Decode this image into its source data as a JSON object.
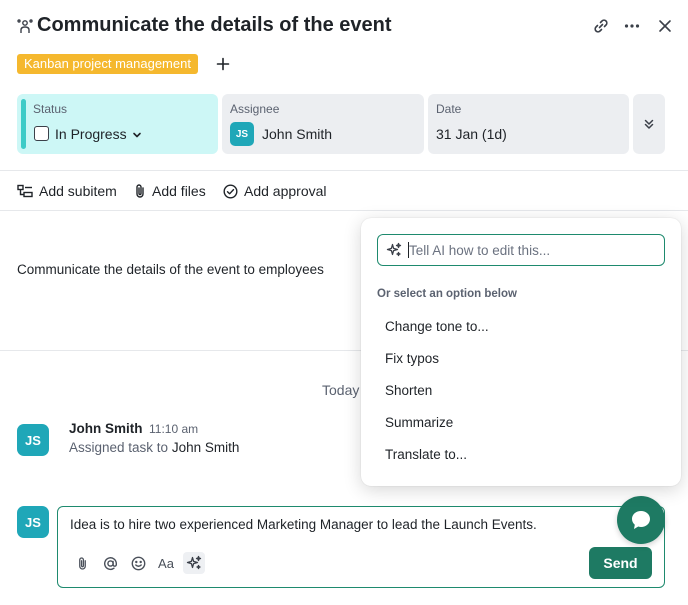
{
  "header": {
    "title": "Communicate the details of the event",
    "tag": "Kanban project management"
  },
  "fields": {
    "status": {
      "label": "Status",
      "value": "In Progress"
    },
    "assignee": {
      "label": "Assignee",
      "value": "John Smith",
      "initials": "JS"
    },
    "date": {
      "label": "Date",
      "value": "31 Jan (1d)"
    }
  },
  "actions": {
    "add_subitem": "Add subitem",
    "add_files": "Add files",
    "add_approval": "Add approval"
  },
  "description": "Communicate the details of the event to employees",
  "activity": {
    "day_label": "Today",
    "comment": {
      "author": "John Smith",
      "initials": "JS",
      "time": "11:10 am",
      "prefix": "Assigned task to",
      "target": "John Smith"
    }
  },
  "composer": {
    "initials": "JS",
    "text": "Idea is to hire two experienced Marketing Manager to lead the Launch Events.",
    "format_label": "Aa",
    "send_label": "Send"
  },
  "ai_popup": {
    "placeholder": "Tell AI how to edit this...",
    "hint": "Or select an option below",
    "options": [
      "Change tone to...",
      "Fix typos",
      "Shorten",
      "Summarize",
      "Translate to..."
    ]
  },
  "colors": {
    "accent": "#1e7a63",
    "tag_bg": "#f5b82e",
    "status_bg": "#cdf7f6",
    "avatar_bg": "#1fa7b8"
  }
}
